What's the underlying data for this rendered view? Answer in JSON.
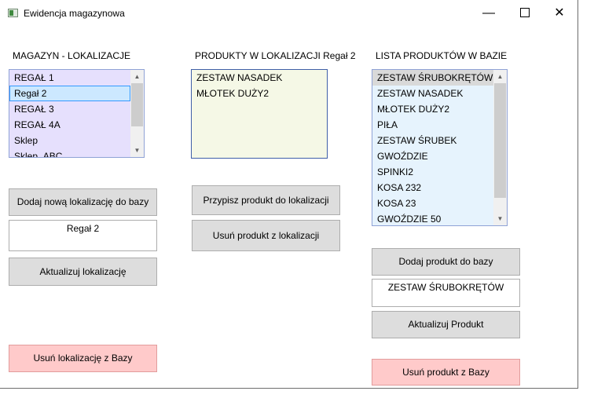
{
  "window": {
    "title": "Ewidencja magazynowa",
    "controls": {
      "minimize": "—",
      "close": "✕"
    }
  },
  "locations": {
    "header": "MAGAZYN - LOKALIZACJE",
    "items": [
      "REGAŁ 1",
      "Regał 2",
      "REGAŁ 3",
      "REGAŁ 4A",
      "Sklep",
      "Sklep_ABC"
    ],
    "selected": "Regał 2",
    "background": "#e6e0fd",
    "add_button": "Dodaj nową lokalizację do bazy",
    "name_field_value": "Regał 2",
    "update_button": "Aktualizuj lokalizację",
    "delete_button": "Usuń lokalizację z Bazy"
  },
  "location_products": {
    "header": "PRODUKTY W LOKALIZACJI Regał 2",
    "items": [
      "ZESTAW NASADEK",
      "MŁOTEK DUŻY2"
    ],
    "background": "#f5f8e6",
    "assign_button": "Przypisz produkt do lokalizacji",
    "remove_button": "Usuń produkt z lokalizacji"
  },
  "product_list": {
    "header": "LISTA PRODUKTÓW W BAZIE",
    "items": [
      "ZESTAW ŚRUBOKRĘTÓW",
      "ZESTAW NASADEK",
      "MŁOTEK DUŻY2",
      "PIŁA",
      "ZESTAW ŚRUBEK",
      "GWOŹDZIE",
      "SPINKI2",
      "KOSA 232",
      "KOSA 23",
      "GWOŹDZIE 50"
    ],
    "highlighted": "ZESTAW ŚRUBOKRĘTÓW",
    "background": "#e6f3fd",
    "add_button": "Dodaj produkt do bazy",
    "name_field_value": "ZESTAW ŚRUBOKRĘTÓW",
    "update_button": "Aktualizuj Produkt",
    "delete_button": "Usuń produkt z Bazy"
  },
  "colors": {
    "button": "#dddddd",
    "danger_button": "#ffcaca",
    "selection": "#cce8ff",
    "selection_border": "#3399ff"
  }
}
